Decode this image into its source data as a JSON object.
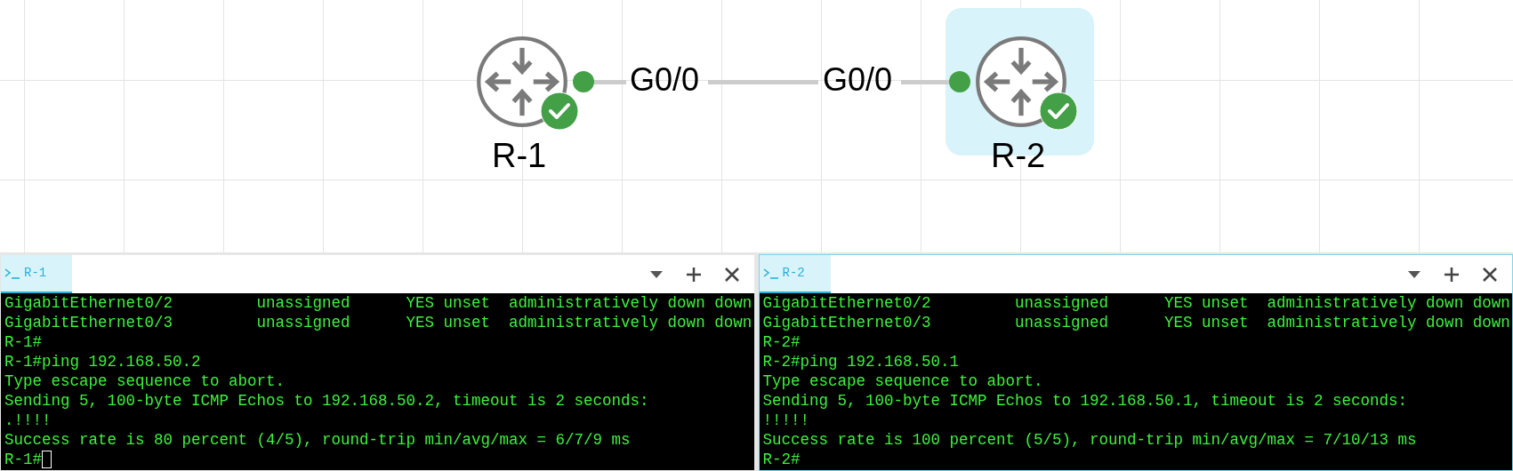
{
  "topology": {
    "nodes": [
      {
        "label": "R-1",
        "running": true,
        "selected": false
      },
      {
        "label": "R-2",
        "running": true,
        "selected": true
      }
    ],
    "links": [
      {
        "from_interface": "G0/0",
        "to_interface": "G0/0",
        "up": true
      }
    ]
  },
  "terminals": [
    {
      "tab": {
        "label": "R-1",
        "selected": true
      },
      "focused": false,
      "cursor": true,
      "lines": [
        "GigabitEthernet0/2         unassigned      YES unset  administratively down down",
        "GigabitEthernet0/3         unassigned      YES unset  administratively down down",
        "R-1#",
        "R-1#ping 192.168.50.2",
        "Type escape sequence to abort.",
        "Sending 5, 100-byte ICMP Echos to 192.168.50.2, timeout is 2 seconds:",
        ".!!!!",
        "Success rate is 80 percent (4/5), round-trip min/avg/max = 6/7/9 ms",
        "R-1#"
      ]
    },
    {
      "tab": {
        "label": "R-2",
        "selected": true
      },
      "focused": true,
      "cursor": false,
      "lines": [
        "GigabitEthernet0/2         unassigned      YES unset  administratively down down",
        "GigabitEthernet0/3         unassigned      YES unset  administratively down down",
        "R-2#",
        "R-2#ping 192.168.50.1",
        "Type escape sequence to abort.",
        "Sending 5, 100-byte ICMP Echos to 192.168.50.1, timeout is 2 seconds:",
        "!!!!!",
        "Success rate is 100 percent (5/5), round-trip min/avg/max = 7/10/13 ms",
        "R-2#"
      ]
    }
  ]
}
